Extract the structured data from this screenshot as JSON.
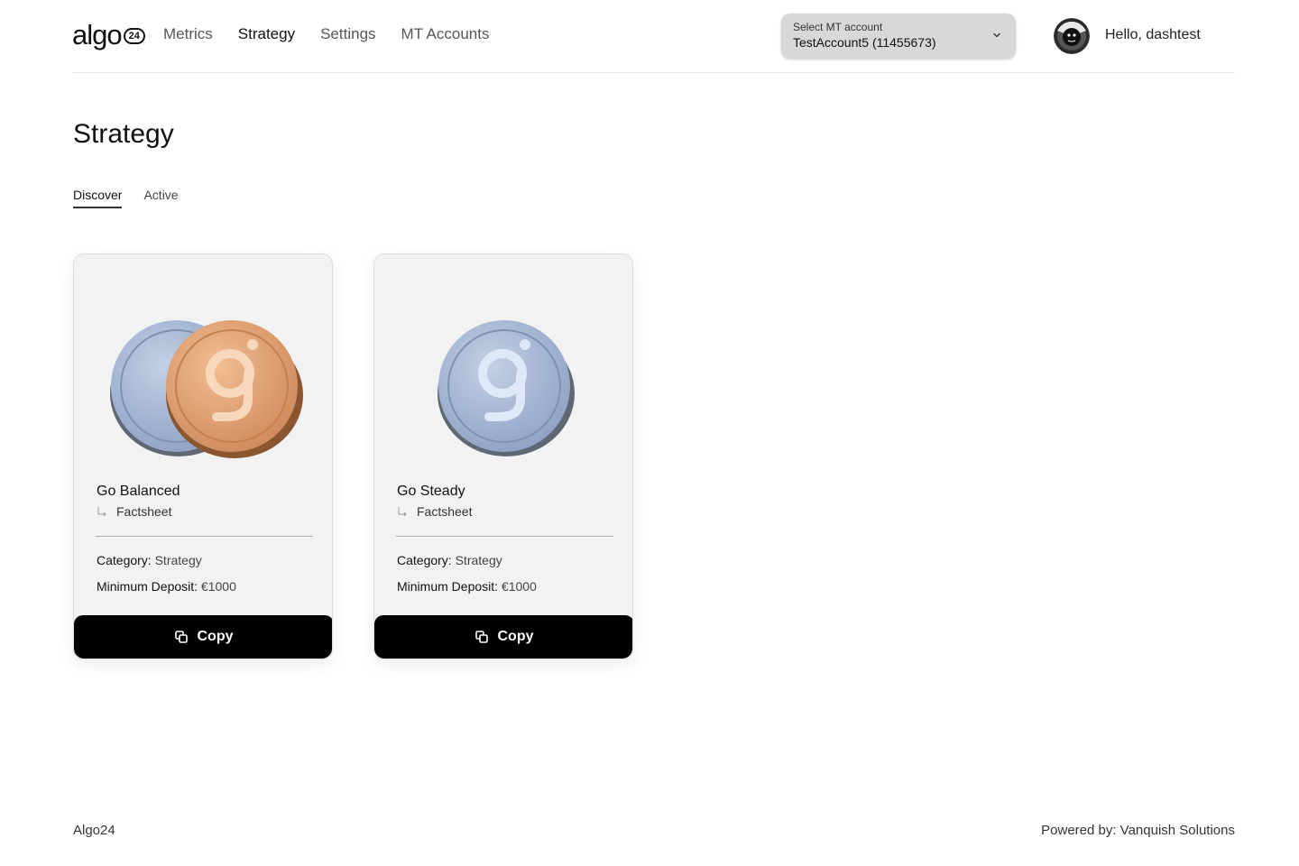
{
  "header": {
    "logo_text": "algo",
    "logo_badge": "24",
    "nav": [
      "Metrics",
      "Strategy",
      "Settings",
      "MT Accounts"
    ],
    "active_nav": "Strategy",
    "account_select": {
      "label": "Select MT account",
      "value": "TestAccount5 (11455673)"
    },
    "greeting": "Hello, dashtest"
  },
  "page": {
    "title": "Strategy",
    "tabs": [
      "Discover",
      "Active"
    ],
    "active_tab": "Discover"
  },
  "strategies": [
    {
      "name": "Go Balanced",
      "factsheet_label": "Factsheet",
      "category_label": "Category:",
      "category_value": "Strategy",
      "deposit_label": "Minimum Deposit:",
      "deposit_value": "€1000",
      "copy_label": "Copy",
      "coins": [
        "silver",
        "bronze"
      ]
    },
    {
      "name": "Go Steady",
      "factsheet_label": "Factsheet",
      "category_label": "Category:",
      "category_value": "Strategy",
      "deposit_label": "Minimum Deposit:",
      "deposit_value": "€1000",
      "copy_label": "Copy",
      "coins": [
        "silver"
      ]
    }
  ],
  "colors": {
    "silver_coin": "#a9b9d4",
    "bronze_coin": "#e3a57a",
    "button_bg": "#000000",
    "card_bg": "#f2f2f2"
  },
  "footer": {
    "left": "Algo24",
    "right": "Powered by: Vanquish Solutions"
  }
}
